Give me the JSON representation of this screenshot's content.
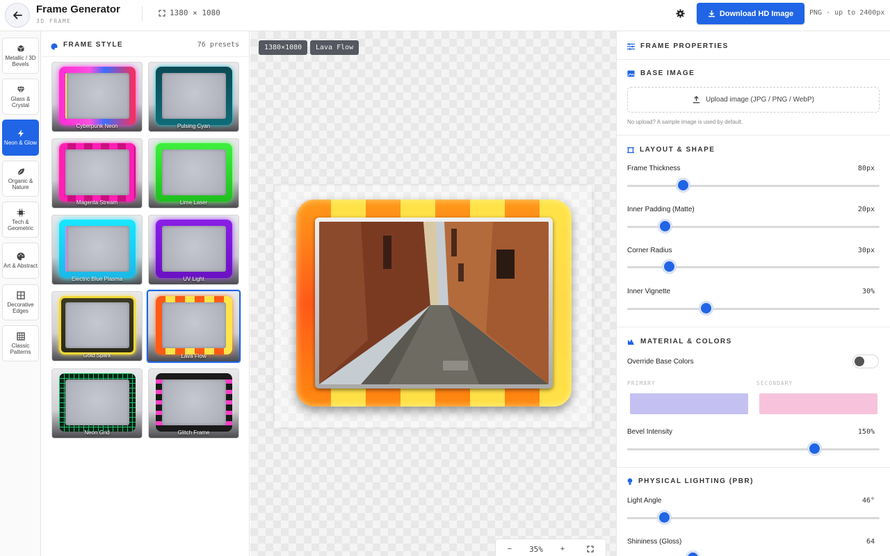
{
  "header": {
    "title": "Frame Generator",
    "subtitle": "3D FRAME",
    "dims": "1380 × 1080",
    "download_label": "Download HD Image",
    "download_note": "PNG · up to 2400px"
  },
  "rail": {
    "items": [
      {
        "label": "Metallic / 3D Bevels"
      },
      {
        "label": "Glass & Crystal"
      },
      {
        "label": "Neon & Glow"
      },
      {
        "label": "Organic & Nature"
      },
      {
        "label": "Tech & Geometric"
      },
      {
        "label": "Art & Abstract"
      },
      {
        "label": "Decorative Edges"
      },
      {
        "label": "Classic Patterns"
      }
    ],
    "active": "Neon & Glow"
  },
  "presets": {
    "title": "FRAME STYLE",
    "count": "76 presets",
    "items": [
      {
        "name": "Cyberpunk Neon"
      },
      {
        "name": "Pulsing Cyan"
      },
      {
        "name": "Magenta Stream"
      },
      {
        "name": "Lime Laser"
      },
      {
        "name": "Electric Blue Plasma"
      },
      {
        "name": "UV Light"
      },
      {
        "name": "Gold Spark"
      },
      {
        "name": "Lava Flow"
      },
      {
        "name": "Neon Grid"
      },
      {
        "name": "Glitch Frame"
      }
    ],
    "selected": "Lava Flow"
  },
  "canvas": {
    "size_chip": "1380×1080",
    "style_chip": "Lava Flow",
    "zoom": "35%",
    "zoom_out": "−",
    "zoom_in": "+"
  },
  "props": {
    "title": "FRAME PROPERTIES",
    "base_image": {
      "title": "BASE IMAGE",
      "upload_label": "Upload image (JPG / PNG / WebP)",
      "hint": "No upload? A sample image is used by default."
    },
    "layout": {
      "title": "LAYOUT & SHAPE",
      "rows": [
        {
          "label": "Frame Thickness",
          "value": "80px",
          "fraction": 0.22
        },
        {
          "label": "Inner Padding (Matte)",
          "value": "20px",
          "fraction": 0.15
        },
        {
          "label": "Corner Radius",
          "value": "30px",
          "fraction": 0.165
        },
        {
          "label": "Inner Vignette",
          "value": "30%",
          "fraction": 0.31
        }
      ]
    },
    "material": {
      "title": "MATERIAL & COLORS",
      "override_label": "Override Base Colors",
      "override_on": false,
      "primary_label": "PRIMARY",
      "secondary_label": "SECONDARY",
      "primary_color": "#c4c1f2",
      "secondary_color": "#f7c3dc",
      "bevel": {
        "label": "Bevel Intensity",
        "value": "150%",
        "fraction": 0.74
      }
    },
    "lighting": {
      "title": "PHYSICAL LIGHTING (PBR)",
      "rows": [
        {
          "label": "Light Angle",
          "value": "46°",
          "fraction": 0.145
        },
        {
          "label": "Shininess (Gloss)",
          "value": "64",
          "fraction": 0.26
        }
      ]
    }
  },
  "colors": {
    "accent": "#2065e5"
  }
}
